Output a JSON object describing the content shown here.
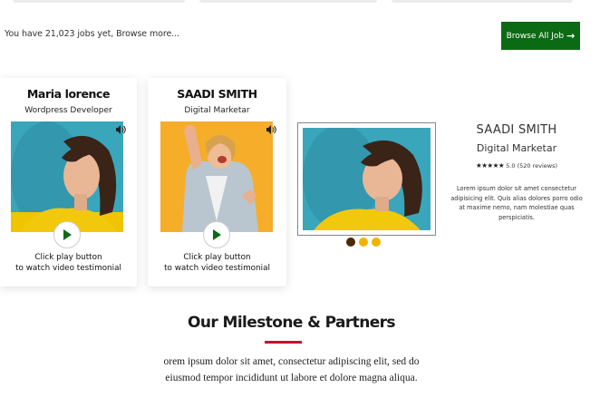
{
  "jobs_banner": {
    "text": "You have 21,023 jobs yet, Browse more...",
    "button_label": "Browse All Job",
    "button_color": "#0b6b14"
  },
  "testimonial_cards": [
    {
      "name": "Maria lorence",
      "role": "Wordpress Developer",
      "caption_line1": "Click play button",
      "caption_line2": "to watch video testimonial",
      "photo_background": "#3aa6bc"
    },
    {
      "name": "SAADI SMITH",
      "role": "Digital Marketar",
      "caption_line1": "Click play button",
      "caption_line2": "to watch video testimonial",
      "photo_background": "#f5ad2a"
    }
  ],
  "featured_testimonial": {
    "name": "SAADI SMITH",
    "role": "Digital Marketar",
    "stars": "★★★★★",
    "rating_text": "5.0 (520 reviews)",
    "body": "Lorem ipsum dolor sit amet consectetur adipisicing elit. Quis alias dolores porro odio at maxime nemo, nam molestiae quas perspiciatis.",
    "dots": [
      "#4a2a00",
      "#f0b400",
      "#f0b400"
    ]
  },
  "milestone": {
    "title": "Our Milestone & Partners",
    "accent_color": "#c8102e",
    "body_line1": "orem ipsum dolor sit amet, consectetur adipiscing elit, sed do",
    "body_line2": "eiusmod tempor incididunt ut labore et dolore magna aliqua."
  },
  "icons": {
    "speaker": "speaker-icon",
    "play": "play-icon",
    "arrow": "arrow-right-icon",
    "star": "star-icon"
  }
}
